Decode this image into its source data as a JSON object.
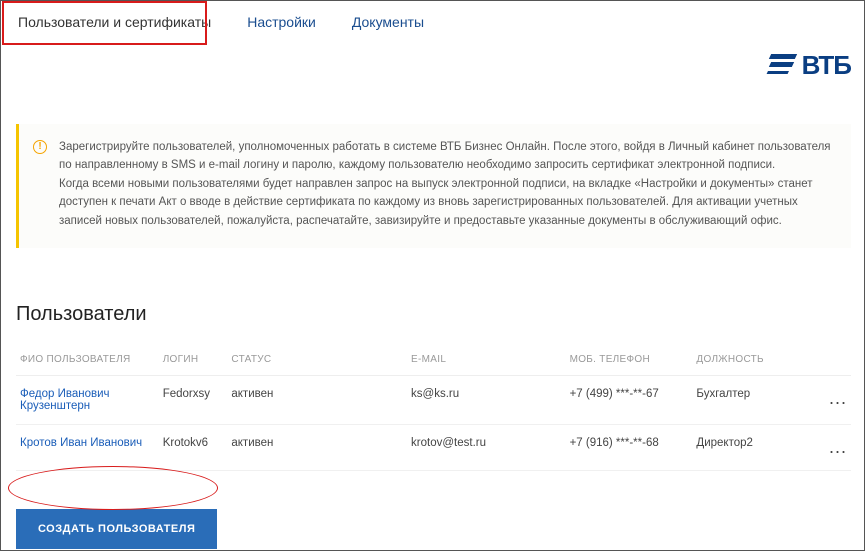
{
  "tabs": {
    "users": "Пользователи и сертификаты",
    "settings": "Настройки",
    "documents": "Документы"
  },
  "logo": {
    "text": "ВТБ"
  },
  "info": {
    "icon_char": "!",
    "text": "Зарегистрируйте пользователей, уполномоченных работать в системе ВТБ Бизнес Онлайн.  После этого, войдя в Личный кабинет пользователя по направленному в SMS и e-mail логину и паролю, каждому пользователю необходимо запросить сертификат электронной подписи.\nКогда всеми новыми пользователями будет направлен запрос на выпуск электронной подписи, на вкладке «Настройки и документы» станет доступен к печати Акт о вводе в действие сертификата по каждому из вновь зарегистрированных пользователей. Для активации учетных записей новых пользователей, пожалуйста, распечатайте, завизируйте и предоставьте указанные документы в обслуживающий офис."
  },
  "section_title": "Пользователи",
  "columns": {
    "name": "ФИО пользователя",
    "login": "Логин",
    "status": "Статус",
    "email": "E-mail",
    "phone": "Моб. телефон",
    "position": "Должность"
  },
  "rows": [
    {
      "name": "Федор Иванович Крузенштерн",
      "login": "Fedorxsy",
      "status": "активен",
      "email": "ks@ks.ru",
      "phone": "+7 (499) ***-**-67",
      "position": "Бухгалтер"
    },
    {
      "name": "Кротов Иван Иванович",
      "login": "Krotokv6",
      "status": "активен",
      "email": "krotov@test.ru",
      "phone": "+7 (916) ***-**-68",
      "position": "Директор2"
    }
  ],
  "create_button": "Создать пользователя",
  "dots": "..."
}
